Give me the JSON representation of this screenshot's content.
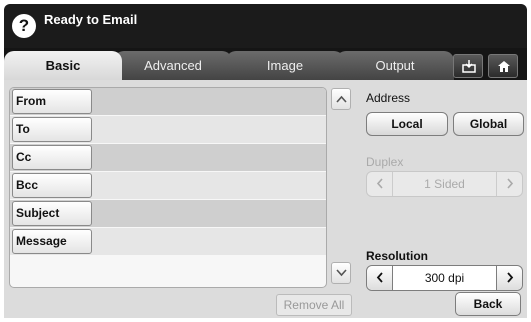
{
  "header": {
    "help_icon": "question-icon",
    "help_glyph": "?",
    "title": "Ready to Email"
  },
  "tabs": [
    {
      "label": "Basic",
      "active": true
    },
    {
      "label": "Advanced",
      "active": false
    },
    {
      "label": "Image",
      "active": false
    },
    {
      "label": "Output",
      "active": false
    }
  ],
  "toolbar_icons": [
    "save-tray-icon",
    "home-icon"
  ],
  "fields": [
    {
      "label": "From",
      "value": ""
    },
    {
      "label": "To",
      "value": ""
    },
    {
      "label": "Cc",
      "value": ""
    },
    {
      "label": "Bcc",
      "value": ""
    },
    {
      "label": "Subject",
      "value": ""
    },
    {
      "label": "Message",
      "value": ""
    }
  ],
  "remove_all": "Remove All",
  "address": {
    "label": "Address",
    "local": "Local",
    "global": "Global"
  },
  "duplex": {
    "label": "Duplex",
    "value": "1 Sided",
    "enabled": false
  },
  "resolution": {
    "label": "Resolution",
    "value": "300 dpi",
    "enabled": true
  },
  "back": "Back",
  "colors": {
    "header_bg": "#1b1b1b",
    "content_bg": "#dcdcdc",
    "disabled_text": "#aaaaaa"
  }
}
